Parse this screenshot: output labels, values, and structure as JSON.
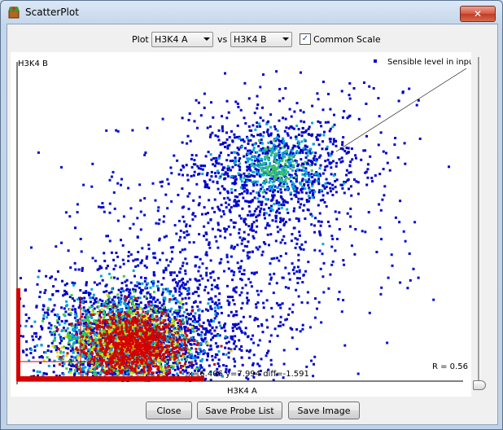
{
  "window": {
    "title": "ScatterPlot",
    "close_glyph": "✕"
  },
  "controls": {
    "plot_label": "Plot",
    "x_select": "H3K4 A",
    "vs_label": "vs",
    "y_select": "H3K4 B",
    "common_scale_label": "Common Scale",
    "common_scale_checked": true,
    "check_glyph": "✓"
  },
  "plot": {
    "y_axis_label": "H3K4 B",
    "x_axis_label": "H3K4 A",
    "legend_label": "Sensible level in input",
    "r_value": "R = 0.56",
    "cursor_readout": "x=6.406 y=7.994 diff=-1.591"
  },
  "buttons": {
    "close": "Close",
    "save_probe_list": "Save Probe List",
    "save_image": "Save Image"
  },
  "colors": {
    "density_low": "#0000c8",
    "density_mid": "#00c8c8",
    "density_high": "#d40000",
    "accent": "#d40000"
  }
}
